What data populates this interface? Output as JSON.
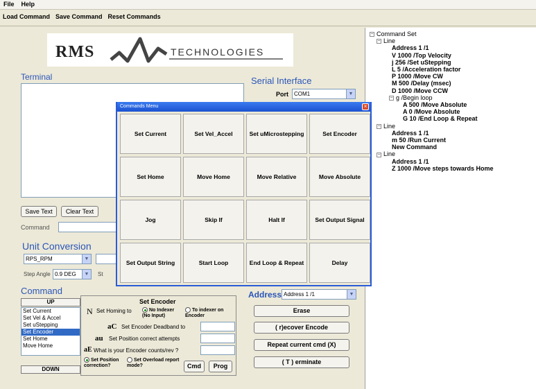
{
  "menu": {
    "file": "File",
    "help": "Help"
  },
  "toolbar": {
    "load": "Load Command",
    "save": "Save Command",
    "reset": "Reset Commands"
  },
  "logo": {
    "text": "RMS TECHNOLOGIES"
  },
  "terminal": {
    "title": "Terminal",
    "save_text": "Save Text",
    "clear_text": "Clear Text",
    "command_label": "Command"
  },
  "serial": {
    "title": "Serial Interface",
    "port_label": "Port",
    "port_value": "COM1"
  },
  "unit": {
    "title": "Unit Conversion",
    "mode": "RPS_RPM",
    "step_angle_label": "Step Angle",
    "step_angle": "0.9 DEG",
    "trailing": "St"
  },
  "command": {
    "title": "Command",
    "up": "UP",
    "down": "DOWN",
    "list": [
      "Set Current",
      "Set Vel & Accel",
      "Set uStepping",
      "Set Encoder",
      "Set Home",
      "Move Home"
    ],
    "selected_index": 3
  },
  "encoder": {
    "title": "Set Encoder",
    "homing_prefix": "N",
    "homing_label": "Set Homing to",
    "opt_no_indexer": "No Indexer (No Input)",
    "opt_to_indexer": "To indexer on Encoder",
    "deadband_prefix": "aC",
    "deadband_label": "Set Encoder Deadband to",
    "attempts_prefix": "au",
    "attempts_label": "Set Position correct attempts",
    "counts_prefix": "aE",
    "counts_label": "What is your Encoder counts/rev ?",
    "opt_set_position": "Set Position correction?",
    "opt_set_overload": "Set Overload report mode?",
    "cmd": "Cmd",
    "prog": "Prog"
  },
  "address": {
    "label": "Address",
    "value": "Address 1 /1"
  },
  "actions": {
    "erase": "Erase",
    "recover": "( r)ecover Encode",
    "repeat": "Repeat current cmd (X)",
    "terminate": "( T ) erminate"
  },
  "dialog": {
    "title": "Commands Menu",
    "buttons": [
      [
        "Set Current",
        "Set Vel_Accel",
        "Set uMicrostepping",
        "Set Encoder"
      ],
      [
        "Set Home",
        "Move Home",
        "Move Relative",
        "Move Absolute"
      ],
      [
        "Jog",
        "Skip If",
        "Halt If",
        "Set Output Signal"
      ],
      [
        "Set Output String",
        "Start Loop",
        "End Loop & Repeat",
        "Delay"
      ]
    ]
  },
  "tree": {
    "root": "Command Set",
    "lines": [
      {
        "label": "Line",
        "children": [
          "Address 1 /1",
          "V 1000 /Top Velocity",
          "j 256 /Set uStepping",
          "L 5 /Acceleration factor",
          "P 1000 /Move CW",
          "M 500 /Delay (msec)",
          "D 1000 /Move CCW"
        ],
        "loop": {
          "label": "g /Begin loop",
          "children": [
            "A 500 /Move Absolute",
            "A 0 /Move Absolute",
            "G 10 /End Loop & Repeat"
          ]
        }
      },
      {
        "label": "Line",
        "children": [
          "Address 1 /1",
          "m 50 /Run Current",
          "New Command"
        ]
      },
      {
        "label": "Line",
        "children": [
          "Address 1 /1",
          "Z 1000 /Move steps towards Home"
        ]
      }
    ]
  }
}
